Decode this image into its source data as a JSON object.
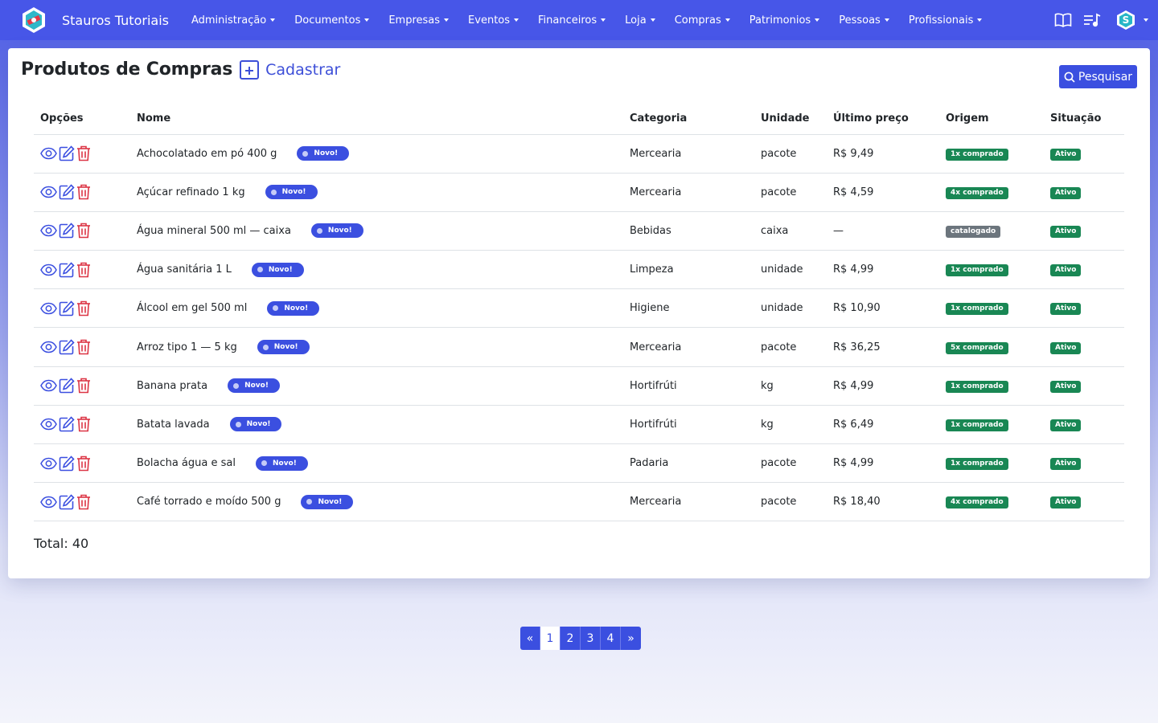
{
  "nav": {
    "brand": "Stauros Tutoriais",
    "items": [
      "Administração",
      "Documentos",
      "Empresas",
      "Eventos",
      "Financeiros",
      "Loja",
      "Compras",
      "Patrimonios",
      "Pessoas",
      "Profissionais"
    ]
  },
  "page": {
    "title": "Produtos de Compras",
    "add_label": "Cadastrar",
    "search_label": "Pesquisar"
  },
  "table": {
    "headers": [
      "Opções",
      "Nome",
      "Categoria",
      "Unidade",
      "Último preço",
      "Origem",
      "Situação"
    ],
    "new_badge": "Novo!",
    "rows": [
      {
        "name": "Achocolatado em pó 400 g",
        "category": "Mercearia",
        "unit": "pacote",
        "price": "R$ 9,49",
        "origin": "1x comprado",
        "origin_type": "green",
        "status": "Ativo"
      },
      {
        "name": "Açúcar refinado 1 kg",
        "category": "Mercearia",
        "unit": "pacote",
        "price": "R$ 4,59",
        "origin": "4x comprado",
        "origin_type": "green",
        "status": "Ativo"
      },
      {
        "name": "Água mineral 500 ml — caixa",
        "category": "Bebidas",
        "unit": "caixa",
        "price": "—",
        "origin": "catalogado",
        "origin_type": "gray",
        "status": "Ativo"
      },
      {
        "name": "Água sanitária 1 L",
        "category": "Limpeza",
        "unit": "unidade",
        "price": "R$ 4,99",
        "origin": "1x comprado",
        "origin_type": "green",
        "status": "Ativo"
      },
      {
        "name": "Álcool em gel 500 ml",
        "category": "Higiene",
        "unit": "unidade",
        "price": "R$ 10,90",
        "origin": "1x comprado",
        "origin_type": "green",
        "status": "Ativo"
      },
      {
        "name": "Arroz tipo 1 — 5 kg",
        "category": "Mercearia",
        "unit": "pacote",
        "price": "R$ 36,25",
        "origin": "5x comprado",
        "origin_type": "green",
        "status": "Ativo"
      },
      {
        "name": "Banana prata",
        "category": "Hortifrúti",
        "unit": "kg",
        "price": "R$ 4,99",
        "origin": "1x comprado",
        "origin_type": "green",
        "status": "Ativo"
      },
      {
        "name": "Batata lavada",
        "category": "Hortifrúti",
        "unit": "kg",
        "price": "R$ 6,49",
        "origin": "1x comprado",
        "origin_type": "green",
        "status": "Ativo"
      },
      {
        "name": "Bolacha água e sal",
        "category": "Padaria",
        "unit": "pacote",
        "price": "R$ 4,99",
        "origin": "1x comprado",
        "origin_type": "green",
        "status": "Ativo"
      },
      {
        "name": "Café torrado e moído 500 g",
        "category": "Mercearia",
        "unit": "pacote",
        "price": "R$ 18,40",
        "origin": "4x comprado",
        "origin_type": "green",
        "status": "Ativo"
      }
    ],
    "total": "Total: 40"
  },
  "pagination": {
    "prev": "«",
    "pages": [
      "1",
      "2",
      "3",
      "4"
    ],
    "current": "1",
    "next": "»"
  },
  "colors": {
    "primary": "#3b4fe0",
    "navbar": "#4756e8",
    "success": "#198754",
    "danger": "#dc3545",
    "secondary": "#6c757d"
  },
  "icons": {
    "view": "eye-icon",
    "edit": "edit-icon",
    "delete": "trash-icon",
    "docs": "book-icon",
    "queue": "playlist-icon",
    "user": "logo-avatar-icon"
  }
}
